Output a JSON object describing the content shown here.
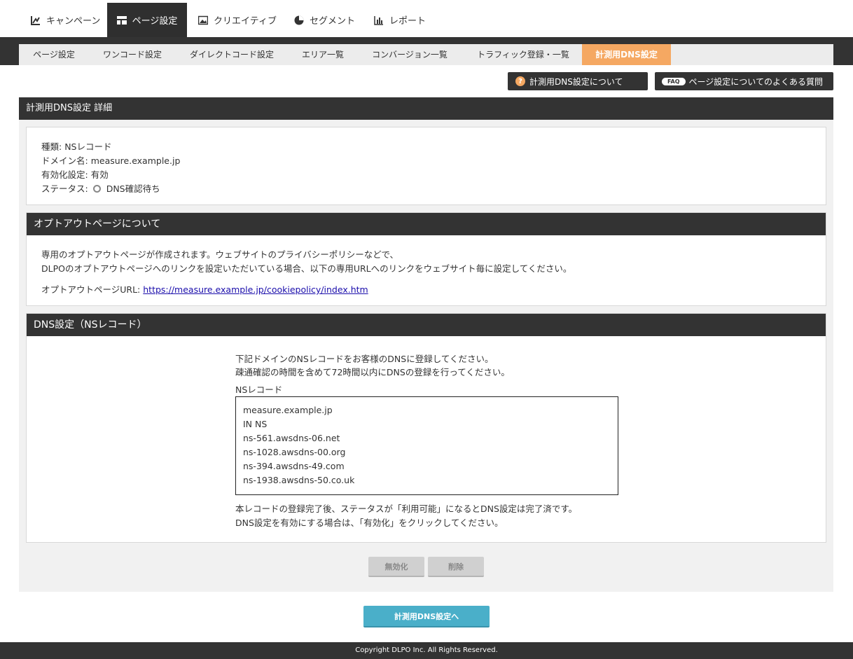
{
  "topnav": {
    "tabs": [
      {
        "label": "キャンペーン",
        "icon": "campaign-icon"
      },
      {
        "label": "ページ設定",
        "icon": "layout-icon",
        "active": true
      },
      {
        "label": "クリエイティブ",
        "icon": "image-icon"
      },
      {
        "label": "セグメント",
        "icon": "pie-chart-icon"
      },
      {
        "label": "レポート",
        "icon": "bar-chart-icon"
      }
    ]
  },
  "subnav": {
    "tabs": [
      {
        "label": "ページ設定"
      },
      {
        "label": "ワンコード設定"
      },
      {
        "label": "ダイレクトコード設定"
      },
      {
        "label": "エリア一覧"
      },
      {
        "label": "コンバージョン一覧"
      },
      {
        "label": "トラフィック登録・一覧"
      },
      {
        "label": "計測用DNS設定",
        "active": true
      }
    ]
  },
  "help": {
    "about_dns_label": "計測用DNS設定について",
    "faq_badge": "FAQ",
    "faq_label": "ページ設定についてのよくある質問"
  },
  "detail": {
    "title": "計測用DNS設定 詳細",
    "type_label": "種類:",
    "type_value": "NSレコード",
    "domain_label": "ドメイン名:",
    "domain_value": "measure.example.jp",
    "enabled_label": "有効化設定:",
    "enabled_value": "有効",
    "status_label": "ステータス:",
    "status_value": "DNS確認待ち"
  },
  "optout": {
    "title": "オプトアウトページについて",
    "line1": "専用のオプトアウトページが作成されます。ウェブサイトのプライバシーポリシーなどで、",
    "line2": "DLPOのオプトアウトページへのリンクを設定いただいている場合、以下の専用URLへのリンクをウェブサイト毎に設定してください。",
    "url_label": "オプトアウトページURL:",
    "url": "https://measure.example.jp/cookiepolicy/index.htm"
  },
  "dns": {
    "title": "DNS設定（NSレコード）",
    "intro1": "下記ドメインのNSレコードをお客様のDNSに登録してください。",
    "intro2": "疎通確認の時間を含めて72時間以内にDNSの登録を行ってください。",
    "record_label": "NSレコード",
    "records": [
      "measure.example.jp",
      "IN NS",
      "ns-561.awsdns-06.net",
      "ns-1028.awsdns-00.org",
      "ns-394.awsdns-49.com",
      "ns-1938.awsdns-50.co.uk"
    ],
    "note1": "本レコードの登録完了後、ステータスが「利用可能」になるとDNS設定は完了済です。",
    "note2": "DNS設定を有効にする場合は、「有効化」をクリックしてください。"
  },
  "actions": {
    "disable_label": "無効化",
    "delete_label": "削除",
    "back_label": "計測用DNS設定へ"
  },
  "footer": {
    "copyright": "Copyright DLPO Inc. All Rights Reserved."
  },
  "colors": {
    "accent": "#f5a862",
    "dark": "#333333",
    "button_blue": "#4aafc9"
  }
}
